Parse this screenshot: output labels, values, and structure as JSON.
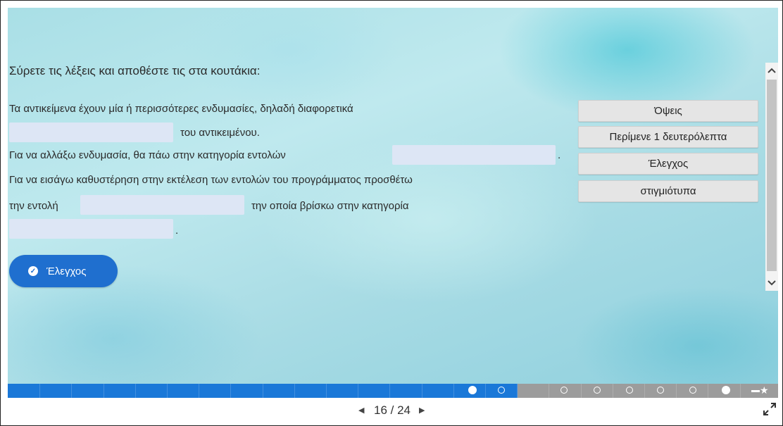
{
  "instruction": "Σύρετε τις λέξεις και αποθέστε τις στα κουτάκια:",
  "text": {
    "line1": "Τα αντικείμενα έχουν μία ή περισσότερες ενδυμασίες, δηλαδή διαφορετικά",
    "line2_after": "του αντικειμένου.",
    "line3_before": "Για να αλλάξω ενδυμασία, θα πάω στην κατηγορία εντολών",
    "line3_after": ".",
    "line4": "Για να εισάγω καθυστέρηση στην εκτέλεση των εντολών του προγράμματος προσθέτω",
    "line5_before": "την εντολή",
    "line5_after": "την οποία βρίσκω στην κατηγορία",
    "line6_after": "."
  },
  "words": [
    "Όψεις",
    "Περίμενε 1 δευτερόλεπτα",
    "Έλεγχος",
    "στιγμιότυπα"
  ],
  "check_button": {
    "label": "Έλεγχος",
    "icon": "check-circle-icon"
  },
  "scrollbar": {
    "up_icon": "chevron-up-icon",
    "down_icon": "chevron-down-icon"
  },
  "progress": {
    "current": 16,
    "total": 24
  },
  "navigation": {
    "counter": "16 / 24",
    "prev_icon": "triangle-left-icon",
    "next_icon": "triangle-right-icon",
    "fullscreen_icon": "expand-icon"
  },
  "colors": {
    "accent": "#1f6fcf",
    "progress_done": "#1a78d8",
    "progress_rest": "#9c9c9c",
    "drop_zone": "#dde6f5"
  }
}
